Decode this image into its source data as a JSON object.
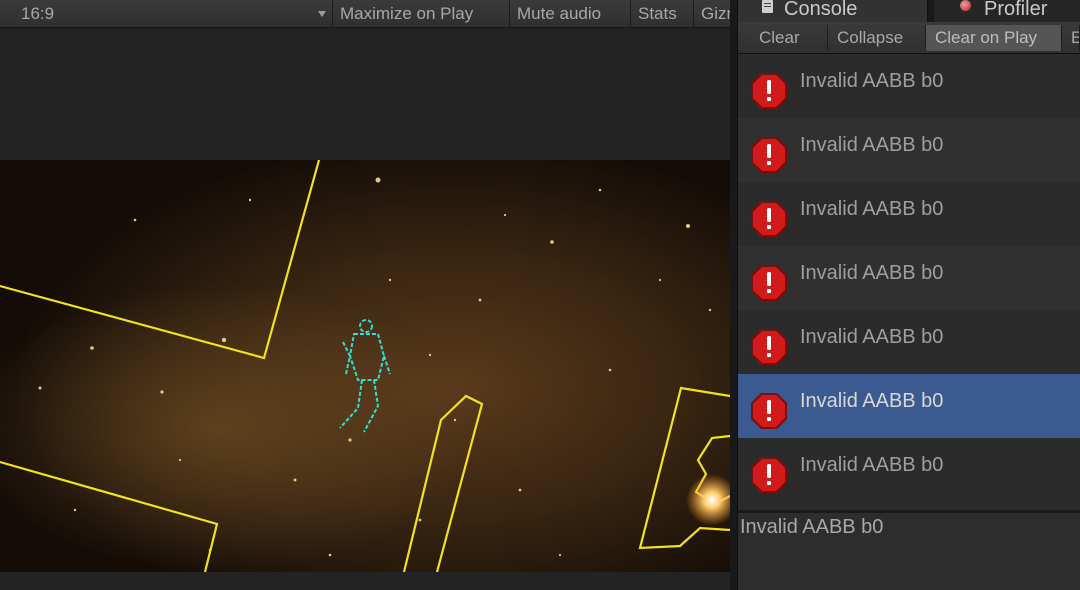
{
  "game_view": {
    "aspect_label": "16:9",
    "maximize_label": "Maximize on Play",
    "mute_label": "Mute audio",
    "stats_label": "Stats",
    "gizmos_label": "Gizmos"
  },
  "tabs": [
    {
      "label": "Console",
      "icon": "console-icon"
    },
    {
      "label": "Profiler",
      "icon": "profiler-icon"
    }
  ],
  "console_toolbar": {
    "clear": "Clear",
    "collapse": "Collapse",
    "clear_on_play": "Clear on Play",
    "error_pause": "Error Pause"
  },
  "logs": [
    {
      "text": "Invalid AABB b0",
      "type": "error"
    },
    {
      "text": "Invalid AABB b0",
      "type": "error"
    },
    {
      "text": "Invalid AABB b0",
      "type": "error"
    },
    {
      "text": "Invalid AABB b0",
      "type": "error"
    },
    {
      "text": "Invalid AABB b0",
      "type": "error"
    },
    {
      "text": "Invalid AABB b0",
      "type": "error",
      "selected": true
    },
    {
      "text": "Invalid AABB b0",
      "type": "error"
    }
  ],
  "detail": {
    "text": "Invalid AABB b0"
  },
  "colors": {
    "selection": "#3b5a8f",
    "error_icon": "#d11a1a",
    "wall_outline": "#f2e21c",
    "player_outline": "#2fe0d0"
  }
}
